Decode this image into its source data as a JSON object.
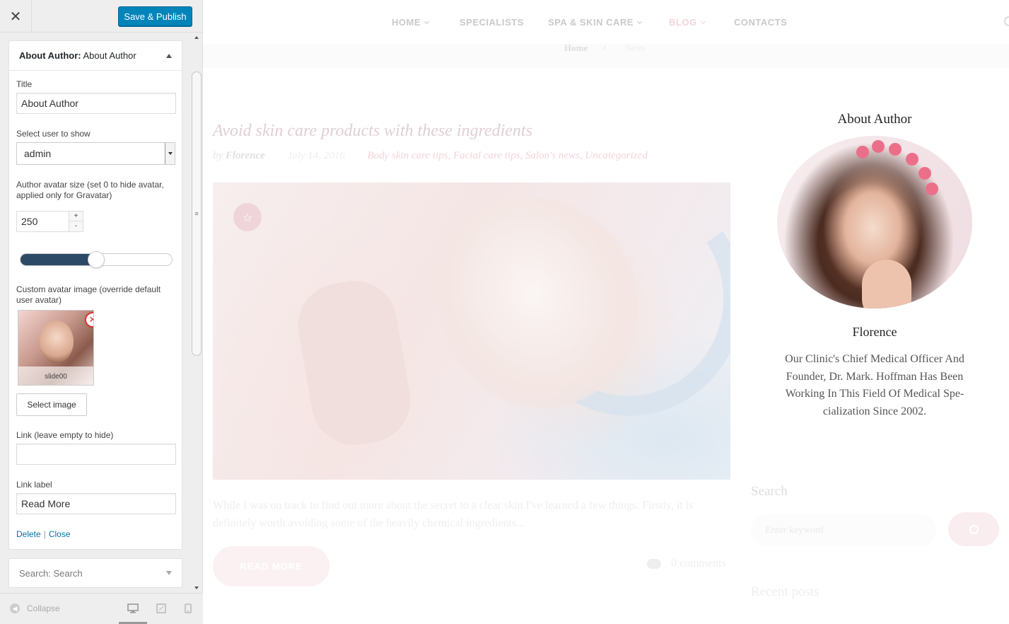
{
  "customizer": {
    "close_icon": "close-icon",
    "save_label": "Save & Publish",
    "widget": {
      "title_prefix": "About Author:",
      "title_name": "About Author",
      "title_label": "Title",
      "title_value": "About Author",
      "user_label": "Select user to show",
      "user_value": "admin",
      "size_label": "Author avatar size (set 0 to hide avatar, applied only for Gravatar)",
      "size_value": "250",
      "size_slider_fraction": 0.5,
      "custom_avatar_label": "Custom avatar image (override default user avatar)",
      "avatar_filename": "slide00",
      "select_image_label": "Select image",
      "link_label": "Link (leave empty to hide)",
      "link_value": "",
      "link_label_label": "Link label",
      "link_label_value": "Read More",
      "delete_label": "Delete",
      "separator": "|",
      "close_label": "Close"
    },
    "search_widget": {
      "prefix": "Search:",
      "name": "Search"
    },
    "footer": {
      "collapse_label": "Collapse",
      "devices": [
        "desktop-icon",
        "tablet-icon",
        "mobile-icon"
      ],
      "active_device": "desktop"
    },
    "colors": {
      "primary": "#0085ba",
      "slider_fill": "#2c4a66",
      "remove": "#dc3232",
      "link": "#0073aa"
    }
  },
  "preview": {
    "nav": [
      {
        "label": "HOME",
        "dropdown": true
      },
      {
        "label": "SPECIALISTS",
        "dropdown": false
      },
      {
        "label": "SPA & SKIN CARE",
        "dropdown": true
      },
      {
        "label": "BLOG",
        "dropdown": true,
        "active": true
      },
      {
        "label": "CONTACTS",
        "dropdown": false
      }
    ],
    "breadcrumb": {
      "home": "Home",
      "separator": "›",
      "current": "News"
    },
    "post": {
      "title": "Avoid skin care products with these ingredients",
      "by": "by",
      "author": "Florence",
      "date": "July 14, 2016",
      "categories": "Body skin care tips, Facial care tips, Salon's news, Uncategorized",
      "excerpt": "While I was on track to find out more about the secret to a clear skin I've learned a few things. Firstly, it is definitely worth avoiding some of the heavily chemical ingredients...",
      "read_more": "READ MORE",
      "comments": "0 comments"
    },
    "sidebar": {
      "about_title": "About Author",
      "about_name": "Florence",
      "about_bio": "Our Clinic's Chief Medical Officer And Founder, Dr. Mark. Hoffman Has Been Working In This Field Of Medical Spe­cialization Since 2002.",
      "search_title": "Search",
      "search_placeholder": "Enter keyword",
      "recent_title": "Recent posts"
    },
    "colors": {
      "accent_pink": "#f4d3d9",
      "nav_text": "#c9c9c9"
    }
  }
}
